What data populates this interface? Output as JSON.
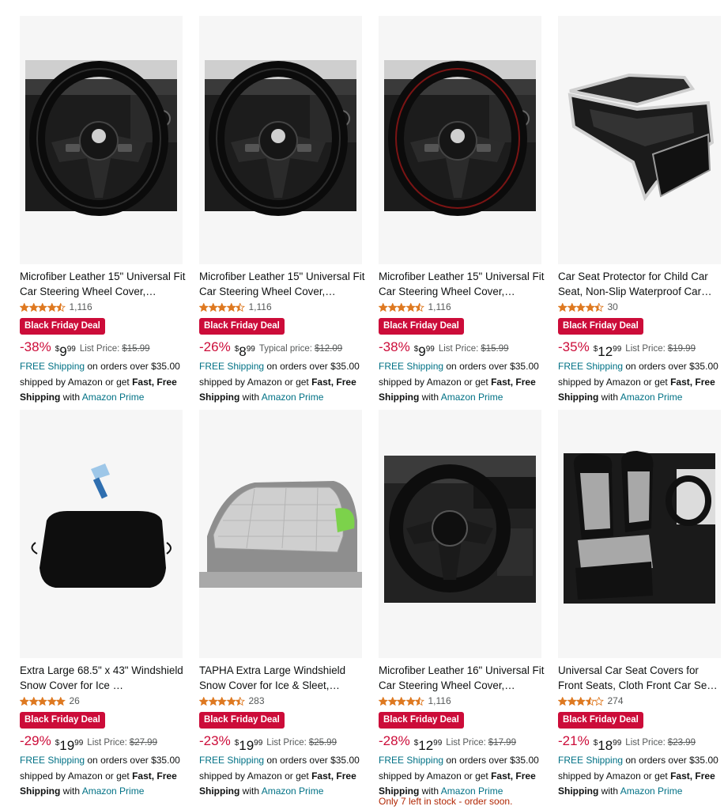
{
  "products": [
    {
      "title": "Microfiber Leather 15\" Universal Fit Car Steering Wheel Cover,…",
      "rating": 4.5,
      "rating_count": "1,116",
      "badge": "Black Friday Deal",
      "discount": "-38%",
      "price_symbol": "$",
      "price_whole": "9",
      "price_fraction": "99",
      "price_label": "List Price:",
      "list_price": "$15.99",
      "image_icon": "steering-wheel-cover-icon"
    },
    {
      "title": "Microfiber Leather 15\" Universal Fit Car Steering Wheel Cover,…",
      "rating": 4.5,
      "rating_count": "1,116",
      "badge": "Black Friday Deal",
      "discount": "-26%",
      "price_symbol": "$",
      "price_whole": "8",
      "price_fraction": "99",
      "price_label": "Typical price:",
      "list_price": "$12.09",
      "image_icon": "steering-wheel-cover-icon"
    },
    {
      "title": "Microfiber Leather 15\" Universal Fit Car Steering Wheel Cover,…",
      "rating": 4.5,
      "rating_count": "1,116",
      "badge": "Black Friday Deal",
      "discount": "-38%",
      "price_symbol": "$",
      "price_whole": "9",
      "price_fraction": "99",
      "price_label": "List Price:",
      "list_price": "$15.99",
      "image_icon": "steering-wheel-cover-icon"
    },
    {
      "title": "Car Seat Protector for Child Car Seat, Non-Slip Waterproof Car…",
      "rating": 4.5,
      "rating_count": "30",
      "badge": "Black Friday Deal",
      "discount": "-35%",
      "price_symbol": "$",
      "price_whole": "12",
      "price_fraction": "99",
      "price_label": "List Price:",
      "list_price": "$19.99",
      "image_icon": "seat-protector-icon"
    },
    {
      "title": "Extra Large 68.5\" x 43\" Windshield Snow Cover for Ice …",
      "rating": 5,
      "rating_count": "26",
      "badge": "Black Friday Deal",
      "discount": "-29%",
      "price_symbol": "$",
      "price_whole": "19",
      "price_fraction": "99",
      "price_label": "List Price:",
      "list_price": "$27.99",
      "image_icon": "windshield-cover-icon"
    },
    {
      "title": "TAPHA Extra Large Windshield Snow Cover for Ice & Sleet,…",
      "rating": 4.5,
      "rating_count": "283",
      "badge": "Black Friday Deal",
      "discount": "-23%",
      "price_symbol": "$",
      "price_whole": "19",
      "price_fraction": "99",
      "price_label": "List Price:",
      "list_price": "$25.99",
      "image_icon": "car-windshield-cover-icon"
    },
    {
      "title": "Microfiber Leather 16\" Universal Fit Car Steering Wheel Cover,…",
      "rating": 4.5,
      "rating_count": "1,116",
      "badge": "Black Friday Deal",
      "discount": "-28%",
      "price_symbol": "$",
      "price_whole": "12",
      "price_fraction": "99",
      "price_label": "List Price:",
      "list_price": "$17.99",
      "image_icon": "steering-wheel-cover-icon",
      "stock_note": "Only 7 left in stock - order soon."
    },
    {
      "title": "Universal Car Seat Covers for Front Seats, Cloth Front Car Se…",
      "rating": 3.5,
      "rating_count": "274",
      "badge": "Black Friday Deal",
      "discount": "-21%",
      "price_symbol": "$",
      "price_whole": "18",
      "price_fraction": "99",
      "price_label": "List Price:",
      "list_price": "$23.99",
      "image_icon": "car-seat-covers-icon"
    }
  ],
  "shipping": {
    "free_shipping": "FREE Shipping",
    "on_orders": " on orders over $35.00 shipped by Amazon or get ",
    "fast_free": "Fast, Free Shipping",
    "with": " with ",
    "prime": "Amazon Prime"
  },
  "colors": {
    "deal_badge": "#cc0c39",
    "star": "#de7921",
    "link": "#007185",
    "stock": "#b12704"
  }
}
